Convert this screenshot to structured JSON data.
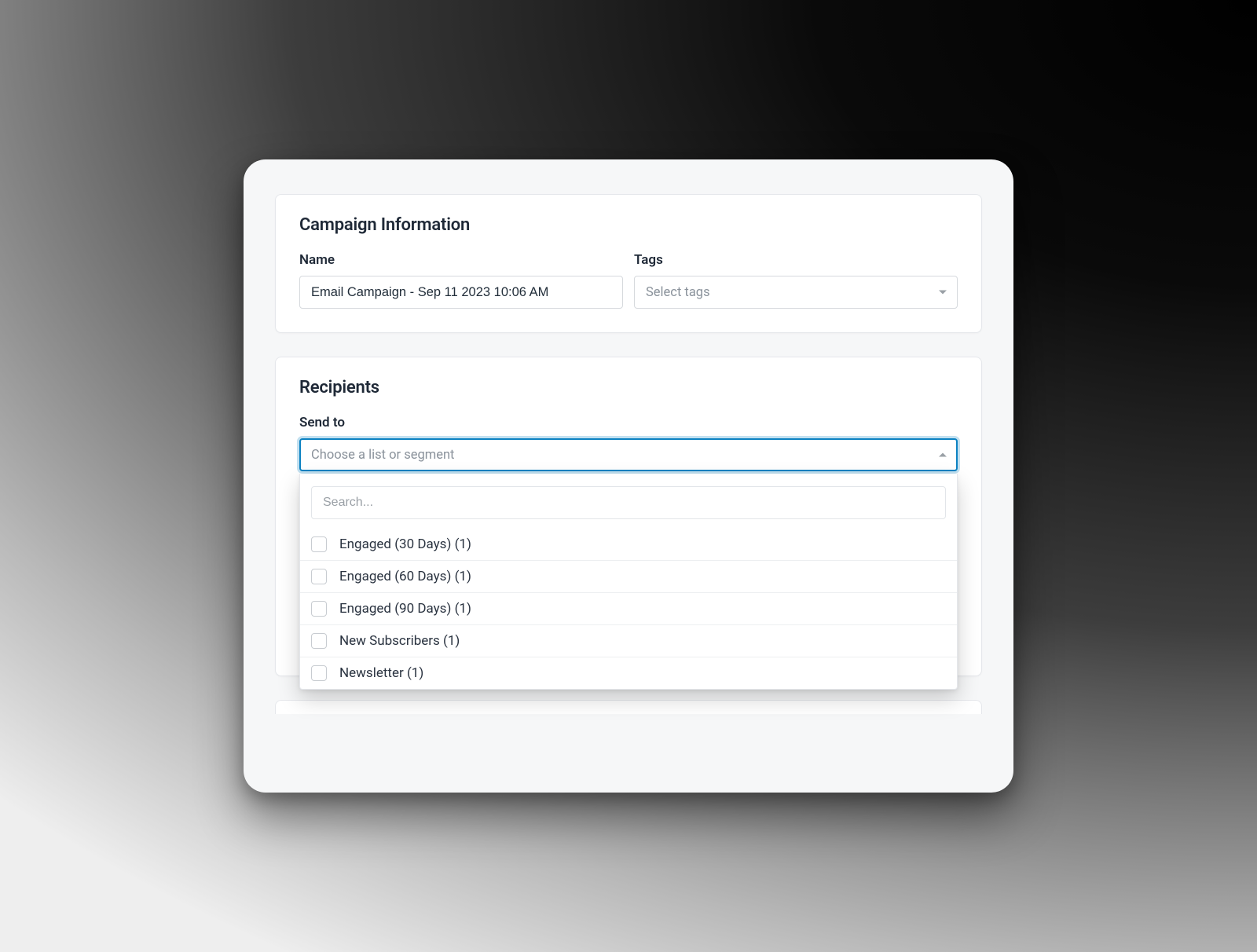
{
  "campaign": {
    "section_title": "Campaign Information",
    "name_label": "Name",
    "name_value": "Email Campaign - Sep 11 2023 10:06 AM",
    "tags_label": "Tags",
    "tags_placeholder": "Select tags"
  },
  "recipients": {
    "section_title": "Recipients",
    "send_to_label": "Send to",
    "select_placeholder": "Choose a list or segment",
    "search_placeholder": "Search...",
    "options": [
      {
        "label": "Engaged (30 Days) (1)"
      },
      {
        "label": "Engaged (60 Days) (1)"
      },
      {
        "label": "Engaged (90 Days) (1)"
      },
      {
        "label": "New Subscribers (1)"
      },
      {
        "label": "Newsletter (1)"
      }
    ]
  }
}
